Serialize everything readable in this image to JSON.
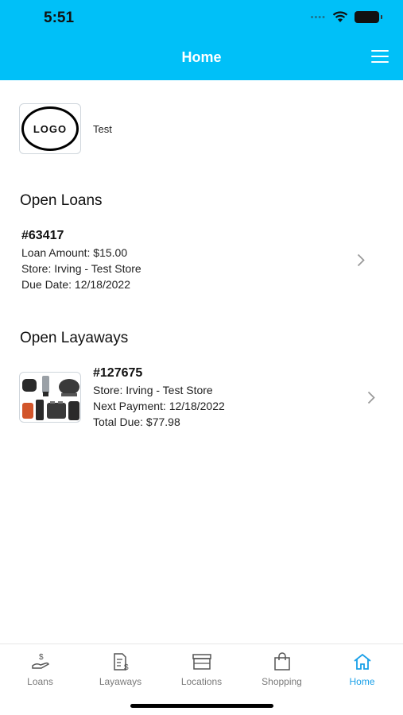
{
  "status_bar": {
    "time": "5:51"
  },
  "header": {
    "title": "Home"
  },
  "profile": {
    "logo_text": "LOGO",
    "name": "Test"
  },
  "open_loans": {
    "title": "Open Loans",
    "items": [
      {
        "number": "#63417",
        "amount": "Loan Amount: $15.00",
        "store": "Store: Irving - Test Store",
        "due": "Due Date: 12/18/2022"
      }
    ]
  },
  "open_layaways": {
    "title": "Open Layaways",
    "items": [
      {
        "number": "#127675",
        "store": "Store: Irving - Test Store",
        "next_payment": "Next Payment: 12/18/2022",
        "total_due": "Total Due: $77.98"
      }
    ]
  },
  "tabs": [
    {
      "label": "Loans",
      "icon": "loans-icon"
    },
    {
      "label": "Layaways",
      "icon": "layaways-icon"
    },
    {
      "label": "Locations",
      "icon": "locations-icon"
    },
    {
      "label": "Shopping",
      "icon": "shopping-bag-icon"
    },
    {
      "label": "Home",
      "icon": "home-icon",
      "active": true
    }
  ],
  "colors": {
    "header": "#00c0f8",
    "active_tab": "#1aa0e8",
    "inactive_tab": "#7a7a7a"
  }
}
